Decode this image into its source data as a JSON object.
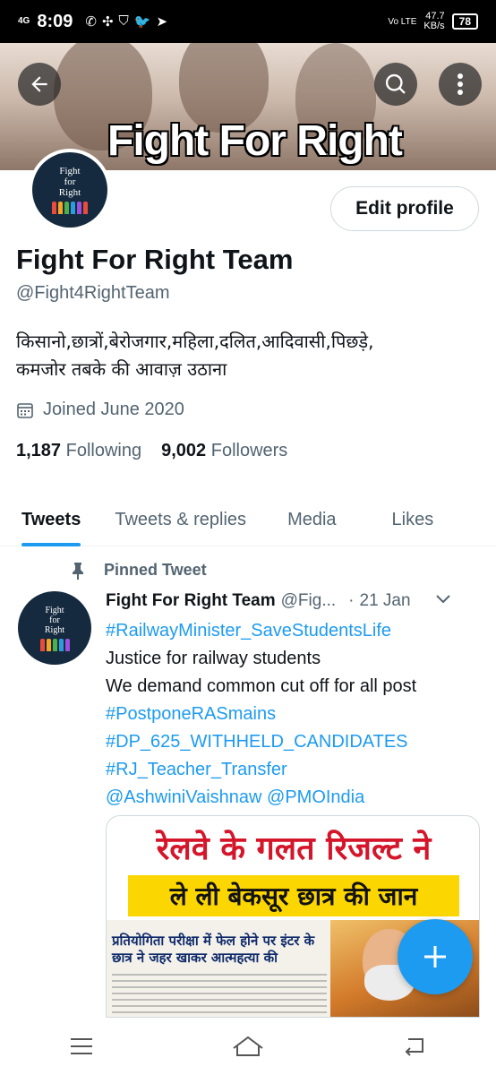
{
  "status_bar": {
    "network": "4G",
    "time": "8:09",
    "volte": "Vo LTE",
    "speed_value": "47.7",
    "speed_unit": "KB/s",
    "battery": "78"
  },
  "banner": {
    "title": "Fight For Right"
  },
  "avatar_text": [
    "Fight",
    "for",
    "Right"
  ],
  "profile": {
    "edit_button": "Edit profile",
    "name": "Fight For Right Team",
    "handle": "@Fight4RightTeam",
    "bio_line1": "किसानो,छात्रों,बेरोजगार,महिला,दलित,आदिवासी,पिछड़े,",
    "bio_line2": "कमजोर तबके की आवाज़ उठाना",
    "joined": "Joined June 2020",
    "following_count": "1,187",
    "following_label": "Following",
    "followers_count": "9,002",
    "followers_label": "Followers"
  },
  "tabs": [
    {
      "label": "Tweets",
      "active": true
    },
    {
      "label": "Tweets & replies",
      "active": false
    },
    {
      "label": "Media",
      "active": false
    },
    {
      "label": "Likes",
      "active": false
    }
  ],
  "tweet": {
    "pinned_label": "Pinned Tweet",
    "author": "Fight For Right Team",
    "handle": "@Fig...",
    "separator": "·",
    "date": "21 Jan",
    "line1": "#RailwayMinister_SaveStudentsLife",
    "line2": "Justice for railway students",
    "line3": "We demand common cut off for all post",
    "line4": "#PostponeRASmains",
    "line5": "#DP_625_WITHHELD_CANDIDATES",
    "line6": "#RJ_Teacher_Transfer",
    "line7": "@AshwiniVaishnaw @PMOIndia"
  },
  "media": {
    "headline1": "रेलवे के गलत रिजल्ट ने",
    "headline2": "ले ली बेकसूर छात्र की जान",
    "paper_headline": "प्रतियोगिता परीक्षा में फेल होने पर इंटर के छात्र ने जहर खाकर आत्महत्या की"
  },
  "colors": {
    "accent": "#1d9bf0",
    "text": "#0f1419",
    "muted": "#536471"
  }
}
